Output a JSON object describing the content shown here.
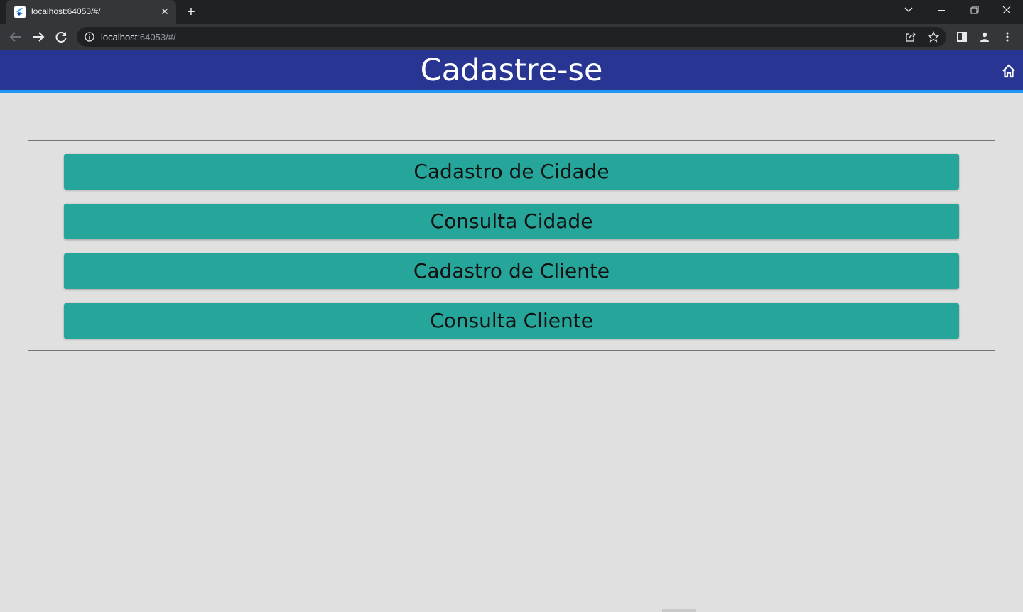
{
  "browser": {
    "tab_title": "localhost:64053/#/",
    "url_host": "localhost",
    "url_rest": ":64053/#/",
    "close_glyph": "✕",
    "new_tab_glyph": "+"
  },
  "app": {
    "title": "Cadastre-se",
    "bar_color": "#283593",
    "accent_color": "#2196f3",
    "button_color": "#26a69a"
  },
  "menu": {
    "buttons": [
      {
        "label": "Cadastro de Cidade"
      },
      {
        "label": "Consulta Cidade"
      },
      {
        "label": "Cadastro de Cliente"
      },
      {
        "label": "Consulta Cliente"
      }
    ]
  },
  "icons": [
    "flutter-favicon",
    "close-icon",
    "plus-icon",
    "chevron-down-icon",
    "minimize-icon",
    "restore-icon",
    "close-window-icon",
    "back-arrow-icon",
    "forward-arrow-icon",
    "reload-icon",
    "info-icon",
    "share-icon",
    "star-icon",
    "side-panel-icon",
    "profile-icon",
    "kebab-menu-icon",
    "home-icon"
  ]
}
